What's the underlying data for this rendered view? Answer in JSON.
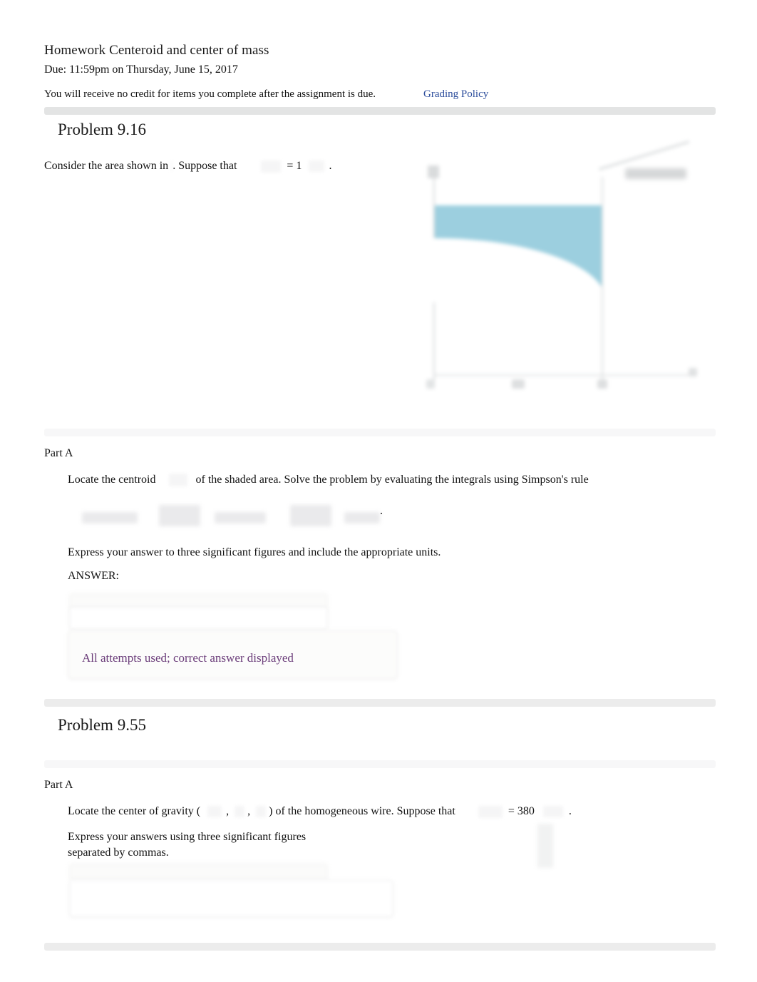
{
  "header": {
    "title": "Homework Centeroid and center of mass",
    "due": "Due: 11:59pm on Thursday, June 15, 2017",
    "notice": "You will receive no credit for items you complete after the assignment is due.",
    "grading_policy_link": "Grading Policy",
    "link_color": "#2b4c9b"
  },
  "problems": [
    {
      "title": "Problem 9.16",
      "intro_before": "Consider the area shown in ",
      "intro_middle": ". Suppose that",
      "intro_value": "= 1",
      "intro_after": ".",
      "figure": {
        "type": "shaded-area-plot",
        "shade_color": "#9ccfdf",
        "description": "Shaded region under a concave-up curve bounded by y-axis and a vertical line"
      },
      "part": {
        "label": "Part A",
        "prompt": "Locate the centroid",
        "prompt_cont": "of the shaded area. Solve the problem by evaluating the integrals using Simpson's rule",
        "formula_trailing": ".",
        "instruction": "Express your answer to three significant figures and include the appropriate units.",
        "answer_label": "ANSWER:",
        "status_message": "All attempts used; correct answer displayed",
        "status_color": "#6b3d7a"
      }
    },
    {
      "title": "Problem 9.55",
      "part": {
        "label": "Part A",
        "prompt_a": "Locate the center of gravity (",
        "prompt_comma1": ",",
        "prompt_comma2": ",",
        "prompt_b": ") of the homogeneous wire. Suppose that",
        "prompt_value": "= 380",
        "prompt_period": ".",
        "instruction_line1": "Express your answers using three significant figures",
        "instruction_line2": "separated by commas."
      }
    }
  ]
}
